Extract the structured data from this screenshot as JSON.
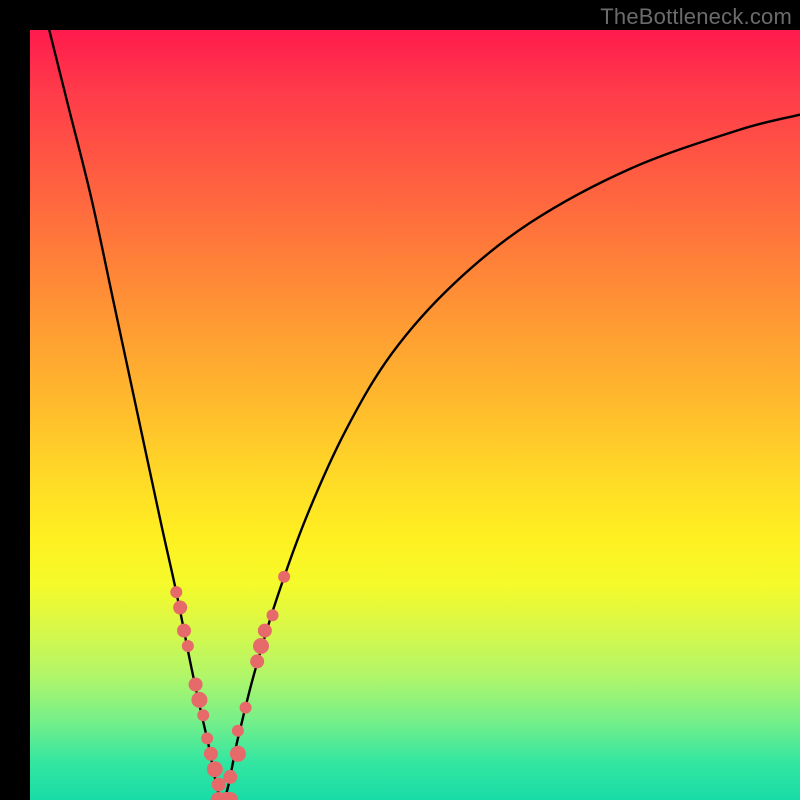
{
  "watermark": "TheBottleneck.com",
  "colors": {
    "curve": "#000000",
    "marker_fill": "#e66a6a",
    "marker_stroke": "#b24f4f",
    "frame": "#000000"
  },
  "chart_data": {
    "type": "line",
    "title": "",
    "xlabel": "",
    "ylabel": "",
    "xlim": [
      0,
      100
    ],
    "ylim": [
      0,
      100
    ],
    "grid": false,
    "legend": false,
    "curve": {
      "min_x": 25.0,
      "left": [
        {
          "x": 2.5,
          "y": 100
        },
        {
          "x": 5,
          "y": 90
        },
        {
          "x": 8,
          "y": 78
        },
        {
          "x": 11,
          "y": 64
        },
        {
          "x": 14,
          "y": 50
        },
        {
          "x": 17,
          "y": 36
        },
        {
          "x": 19,
          "y": 27
        },
        {
          "x": 21,
          "y": 17
        },
        {
          "x": 23,
          "y": 8
        },
        {
          "x": 25,
          "y": 0
        }
      ],
      "right": [
        {
          "x": 25,
          "y": 0
        },
        {
          "x": 27,
          "y": 8
        },
        {
          "x": 29,
          "y": 16
        },
        {
          "x": 32,
          "y": 26
        },
        {
          "x": 36,
          "y": 37
        },
        {
          "x": 41,
          "y": 48
        },
        {
          "x": 47,
          "y": 58
        },
        {
          "x": 55,
          "y": 67
        },
        {
          "x": 65,
          "y": 75
        },
        {
          "x": 78,
          "y": 82
        },
        {
          "x": 92,
          "y": 87
        },
        {
          "x": 100,
          "y": 89
        }
      ]
    },
    "markers": [
      {
        "x": 19.0,
        "y": 27,
        "r": 6
      },
      {
        "x": 19.5,
        "y": 25,
        "r": 7
      },
      {
        "x": 20.0,
        "y": 22,
        "r": 7
      },
      {
        "x": 20.5,
        "y": 20,
        "r": 6
      },
      {
        "x": 21.5,
        "y": 15,
        "r": 7
      },
      {
        "x": 22.0,
        "y": 13,
        "r": 8
      },
      {
        "x": 22.5,
        "y": 11,
        "r": 6
      },
      {
        "x": 23.0,
        "y": 8,
        "r": 6
      },
      {
        "x": 23.5,
        "y": 6,
        "r": 7
      },
      {
        "x": 24.0,
        "y": 4,
        "r": 8
      },
      {
        "x": 24.5,
        "y": 2,
        "r": 7
      },
      {
        "x": 24.5,
        "y": 0,
        "r": 8
      },
      {
        "x": 25.5,
        "y": 0,
        "r": 8
      },
      {
        "x": 26.0,
        "y": 0,
        "r": 8
      },
      {
        "x": 26.0,
        "y": 3,
        "r": 7
      },
      {
        "x": 27.0,
        "y": 6,
        "r": 8
      },
      {
        "x": 27.0,
        "y": 9,
        "r": 6
      },
      {
        "x": 28.0,
        "y": 12,
        "r": 6
      },
      {
        "x": 29.5,
        "y": 18,
        "r": 7
      },
      {
        "x": 30.0,
        "y": 20,
        "r": 8
      },
      {
        "x": 30.5,
        "y": 22,
        "r": 7
      },
      {
        "x": 31.5,
        "y": 24,
        "r": 6
      },
      {
        "x": 33.0,
        "y": 29,
        "r": 6
      }
    ]
  }
}
